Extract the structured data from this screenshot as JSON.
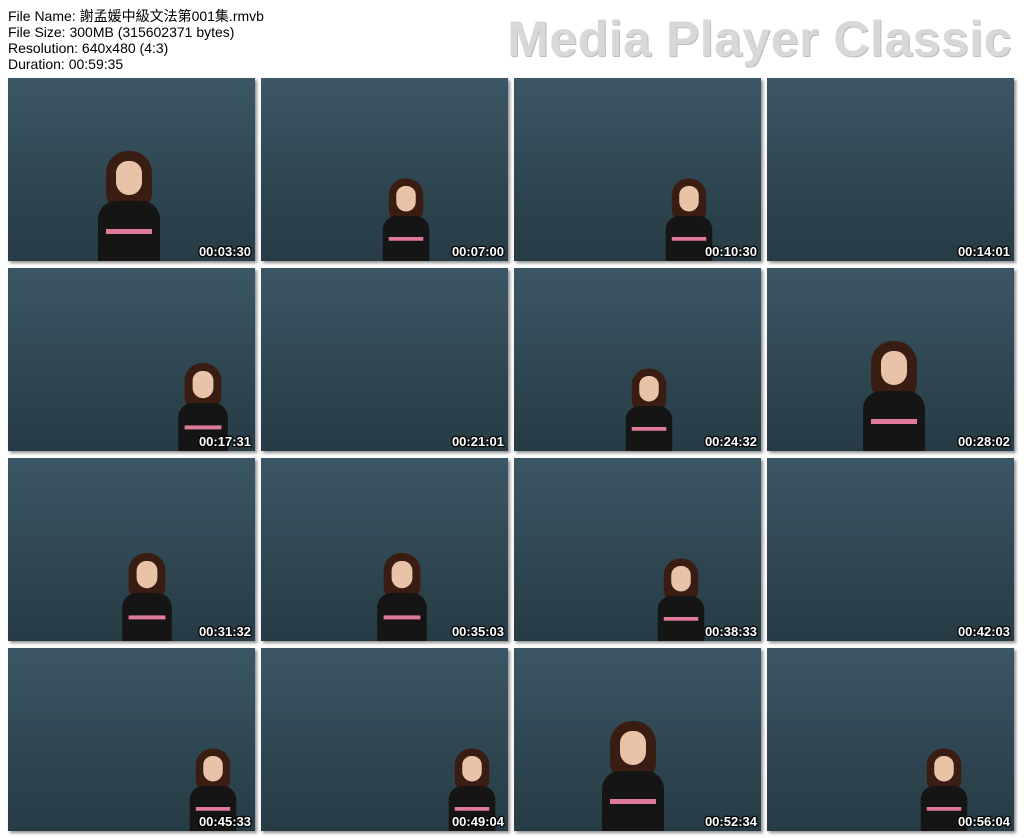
{
  "info": {
    "file_name": "File Name: 謝孟媛中級文法第001集.rmvb",
    "file_size": "File Size: 300MB (315602371 bytes)",
    "resolution": "Resolution: 640x480 (4:3)",
    "duration": "Duration: 00:59:35"
  },
  "brand": "Media Player Classic",
  "thumbs": [
    {
      "time": "00:03:30"
    },
    {
      "time": "00:07:00"
    },
    {
      "time": "00:10:30"
    },
    {
      "time": "00:14:01"
    },
    {
      "time": "00:17:31"
    },
    {
      "time": "00:21:01"
    },
    {
      "time": "00:24:32"
    },
    {
      "time": "00:28:02"
    },
    {
      "time": "00:31:32"
    },
    {
      "time": "00:35:03"
    },
    {
      "time": "00:38:33"
    },
    {
      "time": "00:42:03"
    },
    {
      "time": "00:45:33"
    },
    {
      "time": "00:49:04"
    },
    {
      "time": "00:52:34"
    },
    {
      "time": "00:56:04"
    }
  ],
  "colors": {
    "board": "#2f4450",
    "chalk": "#dfe6ea",
    "accent_pink": "#e07a9a",
    "brand_text": "#d8d8d8"
  }
}
